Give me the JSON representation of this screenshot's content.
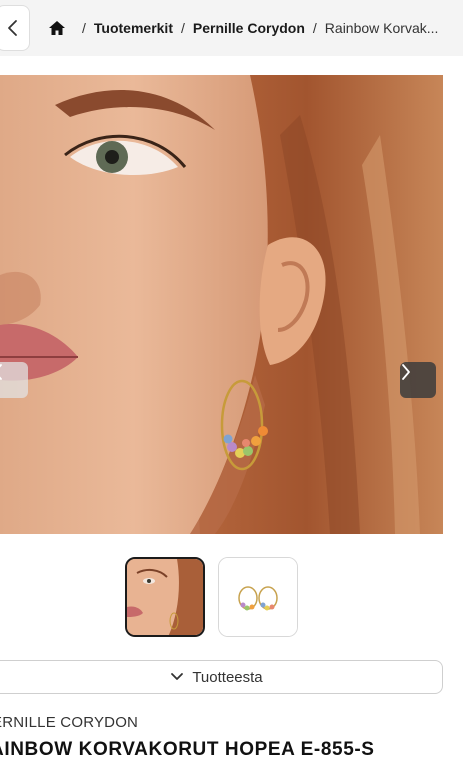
{
  "breadcrumb": {
    "items": [
      "Tuotemerkit",
      "Pernille Corydon"
    ],
    "current": "Rainbow Korvak...",
    "separator": "/"
  },
  "icons": {
    "back": "chevron-left-icon",
    "home": "home-icon",
    "gallery_prev": "chevron-left-icon",
    "gallery_next": "chevron-right-icon",
    "accordion": "chevron-down-icon"
  },
  "accordion": {
    "label": "Tuotteesta"
  },
  "product": {
    "brand": "ERNILLE CORYDON",
    "title": "AINBOW KORVAKORUT HOPEA E-855-S"
  },
  "colors": {
    "topbar_bg": "#f4f4f4",
    "text": "#1b1b1b",
    "border": "#cfcfcf"
  }
}
